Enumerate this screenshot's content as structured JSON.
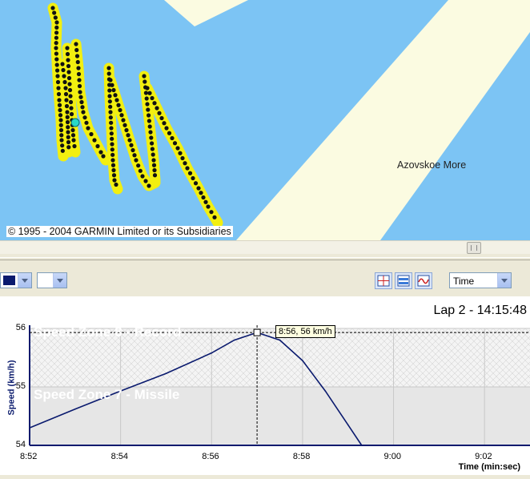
{
  "map": {
    "copyright": "© 1995 - 2004 GARMIN Limited or its Subsidiaries",
    "sea_label": "Azovskoe More",
    "colors": {
      "water": "#7cc4f4",
      "land": "#fbfbe1",
      "track": "#f2ef10",
      "dot": "#111111"
    }
  },
  "toolbar": {
    "color_combo_value": "",
    "secondary_combo_value": "",
    "x_axis_select": "Time",
    "buttons": [
      "crosshair-toggle",
      "zones-toggle",
      "smoothing-toggle"
    ]
  },
  "chart_header": {
    "lap_title": "Lap 2 - 14:15:48"
  },
  "zones": [
    {
      "label": "Speed Zone 8 - Record",
      "range": [
        55,
        56
      ]
    },
    {
      "label": "Speed Zone 7 - Missile",
      "range": [
        54,
        55
      ]
    }
  ],
  "tooltip": "8:56, 56 km/h",
  "chart_data": {
    "type": "line",
    "title": "Lap 2 - 14:15:48",
    "xlabel": "Time (min:sec)",
    "ylabel": "Speed (km/h)",
    "x_ticks": [
      "8:52",
      "8:54",
      "8:56",
      "8:58",
      "9:00",
      "9:02"
    ],
    "y_ticks": [
      "54",
      "55",
      "56"
    ],
    "xlim": [
      "8:52",
      "9:03"
    ],
    "ylim": [
      54,
      56
    ],
    "grid": true,
    "series": [
      {
        "color": "#0a1a6e",
        "points": [
          {
            "x": "8:52",
            "y": 54.3
          },
          {
            "x": "8:53",
            "y": 54.62
          },
          {
            "x": "8:54",
            "y": 54.93
          },
          {
            "x": "8:55",
            "y": 55.23
          },
          {
            "x": "8:56",
            "y": 55.58
          },
          {
            "x": "8:56.5",
            "y": 55.8
          },
          {
            "x": "8:57",
            "y": 55.93
          },
          {
            "x": "8:57.5",
            "y": 55.8
          },
          {
            "x": "8:58",
            "y": 55.45
          },
          {
            "x": "8:58.5",
            "y": 54.93
          },
          {
            "x": "8:59",
            "y": 54.35
          },
          {
            "x": "8:59.3",
            "y": 54.0
          }
        ]
      }
    ],
    "marker": {
      "x": "8:57",
      "y": 55.93
    }
  }
}
